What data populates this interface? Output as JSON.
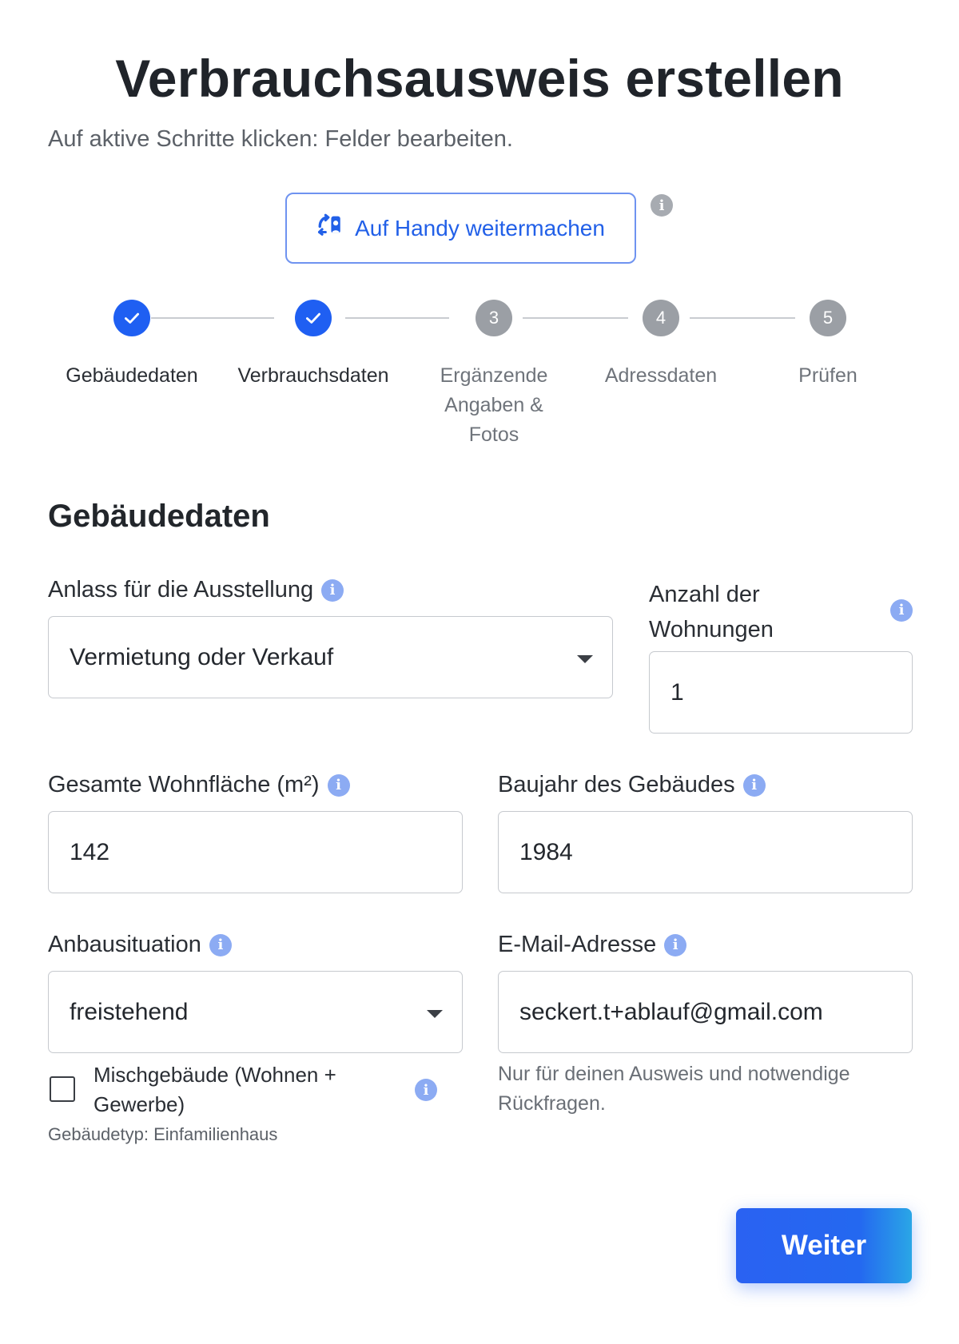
{
  "header": {
    "title": "Verbrauchsausweis erstellen",
    "subtitle": "Auf aktive Schritte klicken: Felder bearbeiten."
  },
  "handy_button": {
    "label": "Auf Handy weitermachen",
    "icon": "phone-sync-icon"
  },
  "info_icon_glyph": "i",
  "stepper": {
    "steps": [
      {
        "number": "1",
        "label": "Gebäudedaten",
        "status": "done"
      },
      {
        "number": "2",
        "label": "Verbrauchsdaten",
        "status": "done"
      },
      {
        "number": "3",
        "label": "Ergänzende Angaben & Fotos",
        "status": "todo"
      },
      {
        "number": "4",
        "label": "Adressdaten",
        "status": "todo"
      },
      {
        "number": "5",
        "label": "Prüfen",
        "status": "todo"
      }
    ]
  },
  "section": {
    "title": "Gebäudedaten"
  },
  "form": {
    "anlass": {
      "label": "Anlass für die Ausstellung",
      "value": "Vermietung oder Verkauf"
    },
    "wohnungen": {
      "label": "Anzahl der Wohnungen",
      "value": "1"
    },
    "wohnflaeche": {
      "label": "Gesamte Wohnfläche (m²)",
      "value": "142"
    },
    "baujahr": {
      "label": "Baujahr des Gebäudes",
      "value": "1984"
    },
    "anbau": {
      "label": "Anbausituation",
      "value": "freistehend"
    },
    "email": {
      "label": "E-Mail-Adresse",
      "value": "seckert.t+ablauf@gmail.com",
      "help": "Nur für deinen Ausweis und notwendige Rückfragen."
    },
    "misch": {
      "label": "Mischgebäude (Wohnen + Gewerbe)",
      "checked": false
    },
    "gebaeudetyp_note": "Gebäudetyp: Einfamilienhaus"
  },
  "footer": {
    "next_label": "Weiter"
  },
  "colors": {
    "primary": "#1f5ff2",
    "step_inactive": "#9b9fa5",
    "info_blue": "#8cabf3"
  }
}
